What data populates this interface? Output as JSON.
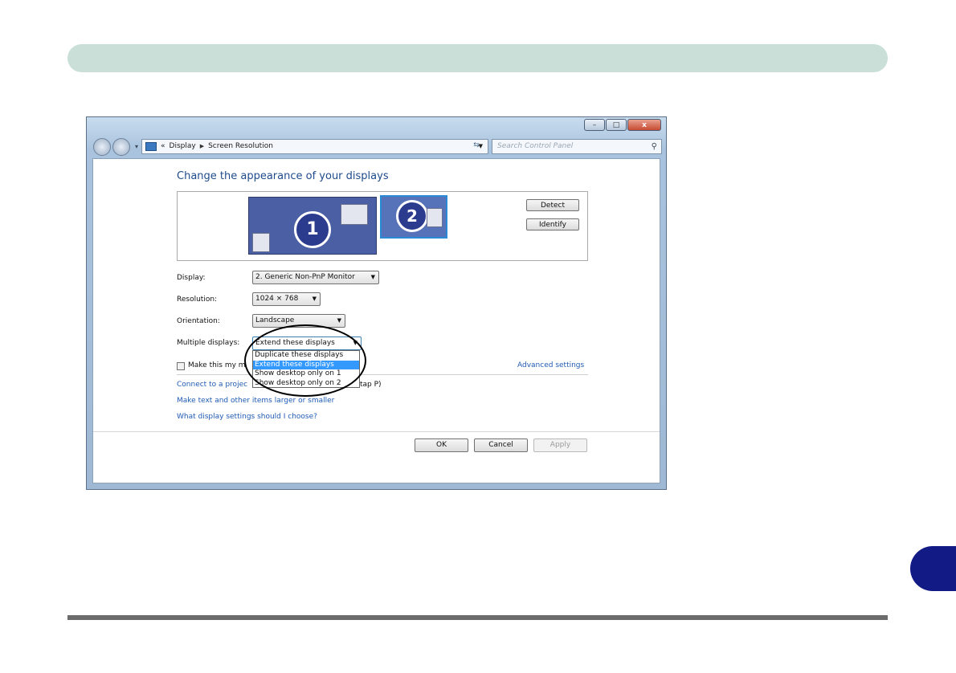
{
  "window": {
    "minimize_label": "–",
    "maximize_label": "□",
    "close_label": "x"
  },
  "address_bar": {
    "prefix": "«",
    "crumb1": "Display",
    "separator": "▶",
    "crumb2": "Screen Resolution"
  },
  "search": {
    "placeholder": "Search Control Panel"
  },
  "main": {
    "title": "Change the appearance of your displays",
    "monitor1_number": "1",
    "monitor2_number": "2",
    "detect_label": "Detect",
    "identify_label": "Identify"
  },
  "form": {
    "display_label": "Display:",
    "display_value": "2. Generic Non-PnP Monitor",
    "resolution_label": "Resolution:",
    "resolution_value": "1024 × 768",
    "orientation_label": "Orientation:",
    "orientation_value": "Landscape",
    "multiple_label": "Multiple displays:",
    "multiple_value": "Extend these displays",
    "multiple_options": [
      "Duplicate these displays",
      "Extend these displays",
      "Show desktop only on 1",
      "Show desktop only on 2"
    ],
    "make_main_label": "Make this my m",
    "advanced_link": "Advanced settings"
  },
  "links": {
    "projector": "Connect to a projec",
    "projector_suffix": "tap P)",
    "text_size": "Make text and other items larger or smaller",
    "help": "What display settings should I choose?"
  },
  "buttons": {
    "ok": "OK",
    "cancel": "Cancel",
    "apply": "Apply"
  }
}
